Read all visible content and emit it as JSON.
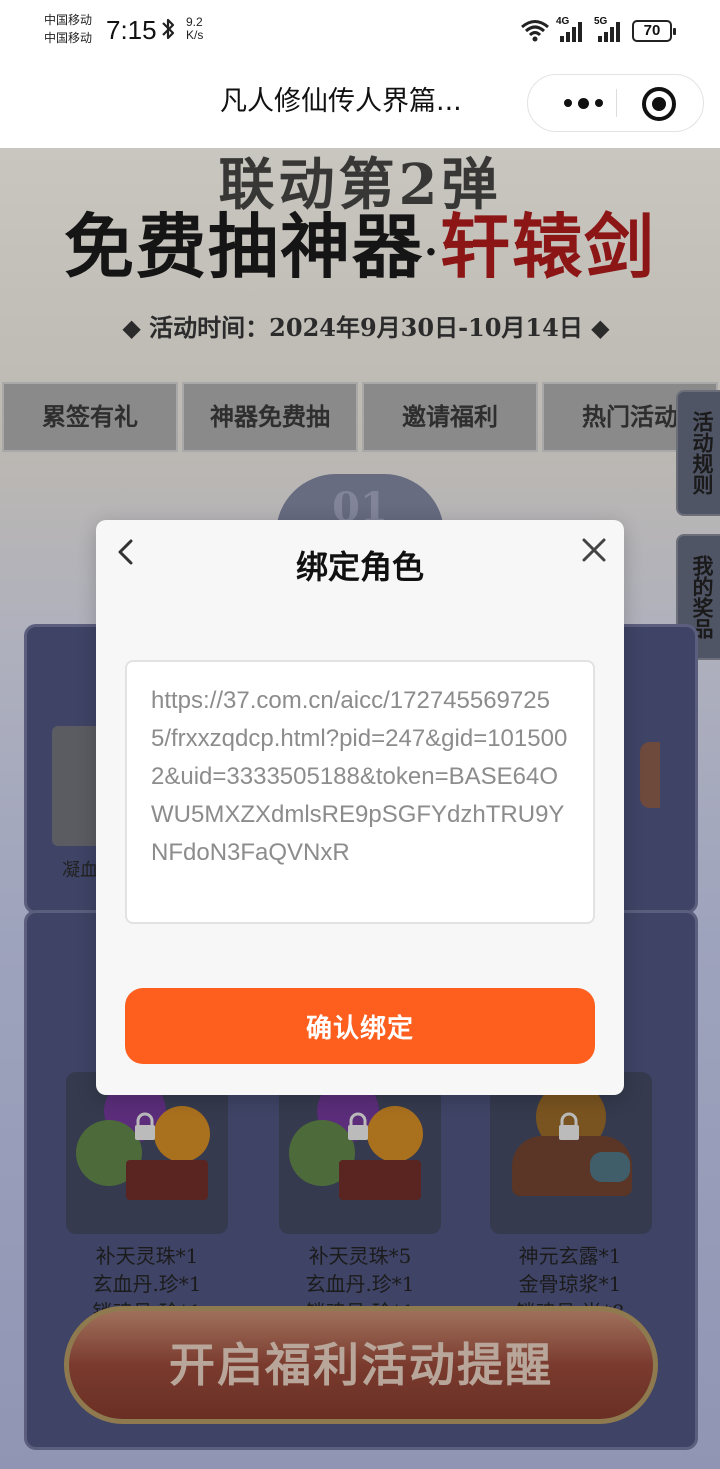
{
  "status_bar": {
    "carrier_1": "中国移动",
    "carrier_2": "中国移动",
    "time": "7:15",
    "speed_value": "9.2",
    "speed_unit": "K/s",
    "net_1": "4G",
    "net_2": "5G",
    "battery": "70"
  },
  "navbar": {
    "title": "凡人修仙传人界篇..."
  },
  "banner": {
    "subtitle": "联动第2弹",
    "title_part_1": "免费抽神器",
    "title_dot": "·",
    "title_part_2": "轩辕剑",
    "event_time": "◆ 活动时间：2024年9月30日-10月14日 ◆"
  },
  "tabs": [
    {
      "label": "累签有礼"
    },
    {
      "label": "神器免费抽"
    },
    {
      "label": "邀请福利"
    },
    {
      "label": "热门活动"
    }
  ],
  "side_buttons": {
    "rules": "活动规则",
    "my_prizes": "我的奖品"
  },
  "badge": "01",
  "left_item_label": "凝血",
  "rewards": [
    {
      "line1": "补天灵珠*1",
      "line2": "玄血丹.珍*1",
      "line3": "锁魂丹.珍*1"
    },
    {
      "line1": "补天灵珠*5",
      "line2": "玄血丹.珍*1",
      "line3": "锁魂丹.珍*1"
    },
    {
      "line1": "神元玄露*1",
      "line2": "金骨琼浆*1",
      "line3": "锁魂丹.尚*8"
    }
  ],
  "cta_label": "开启福利活动提醒",
  "modal": {
    "title": "绑定角色",
    "url_value": "https://37.com.cn/aicc/1727455697255/frxxzqdcp.html?pid=247&gid=1015002&uid=3333505188&token=BASE64OWU5MXZXdmlsRE9pSGFYdzhTRU9YNFdoN3FaQVNxR",
    "confirm_label": "确认绑定"
  },
  "colors": {
    "accent": "#fe5f1f",
    "modal_bg": "#f7f7f7",
    "overlay_panel": "#3f4466"
  }
}
